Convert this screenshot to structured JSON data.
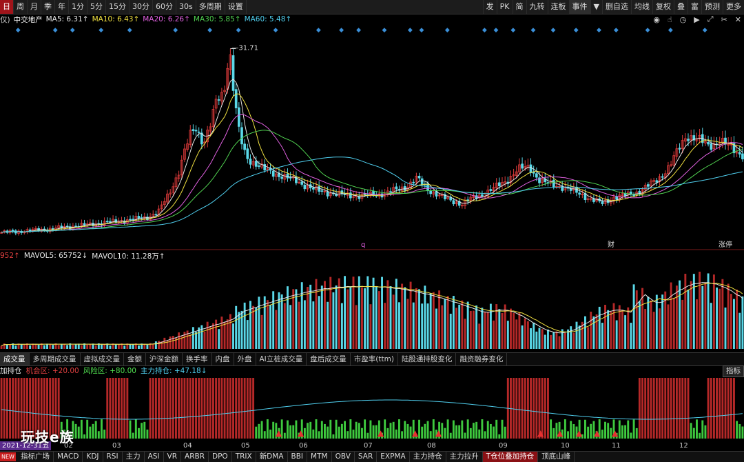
{
  "toolbar": {
    "left": [
      "日",
      "周",
      "月",
      "季",
      "年",
      "1分",
      "5分",
      "15分",
      "30分",
      "60分",
      "30s",
      "多周期",
      "设置"
    ],
    "active": 0,
    "right": [
      "发",
      "PK",
      "简",
      "九转",
      "连板",
      "事件",
      "▼",
      "删自选",
      "均线",
      "复权",
      "叠",
      "富",
      "预测",
      "更多"
    ]
  },
  "ma_legend": {
    "prefix": "仅)",
    "name": "中交地产",
    "items": [
      {
        "text": "MA5: 6.31↑",
        "color": "#e6e6e6"
      },
      {
        "text": "MA10: 6.43↑",
        "color": "#f0e040"
      },
      {
        "text": "MA20: 6.26↑",
        "color": "#e060e0"
      },
      {
        "text": "MA30: 5.85↑",
        "color": "#50d050"
      },
      {
        "text": "MA60: 5.48↑",
        "color": "#50d0f0"
      }
    ]
  },
  "price_chart": {
    "peak_label": "31.71",
    "event_markers": [
      "q",
      "财",
      "涨停"
    ]
  },
  "vol_legend": {
    "items": [
      {
        "text": "952↑",
        "color": "#e04040"
      },
      {
        "text": "MAVOL5: 65752↓",
        "color": "#e6e6e6"
      },
      {
        "text": "MAVOL10: 11.28万↑",
        "color": "#e6e6e6"
      }
    ]
  },
  "indicator_tabs": {
    "items": [
      "成交量",
      "多周期成交量",
      "虚拟成交量",
      "金额",
      "沪深金额",
      "换手率",
      "内盘",
      "外盘",
      "AI立桩成交量",
      "盘后成交量",
      "市盈率(ttm)",
      "陆股通持股变化",
      "融资融券变化"
    ],
    "active": 0
  },
  "sub_legend": {
    "items": [
      {
        "text": "加持仓",
        "color": "#e6e6e6"
      },
      {
        "text": "机会区: +20.00",
        "color": "#e04040"
      },
      {
        "text": "风险区: +80.00",
        "color": "#50e050"
      },
      {
        "text": "主力持仓: +47.18↓",
        "color": "#50d0f0"
      }
    ],
    "right_button": "指标"
  },
  "x_axis": {
    "date_badge": "2021-12-31五",
    "months": [
      "02",
      "03",
      "04",
      "05",
      "06",
      "07",
      "08",
      "09",
      "10",
      "11",
      "12"
    ]
  },
  "watermark": "玩技e族",
  "bottom_tabs": {
    "new_badge": "NEW",
    "items": [
      "指标广场",
      "MACD",
      "KDJ",
      "RSI",
      "主力",
      "ASI",
      "VR",
      "ARBR",
      "DPO",
      "TRIX",
      "新DMA",
      "BBI",
      "MTM",
      "OBV",
      "SAR",
      "EXPMA",
      "主力持仓",
      "主力拉升",
      "T仓位叠加持仓",
      "顶底山峰"
    ],
    "active": 18
  },
  "colors": {
    "up": "#e03b3b",
    "down": "#5ad8e8",
    "ma5": "#e6e6e6",
    "ma10": "#f0e040",
    "ma20": "#e060e0",
    "ma30": "#50d050",
    "ma60": "#50d0f0"
  }
}
